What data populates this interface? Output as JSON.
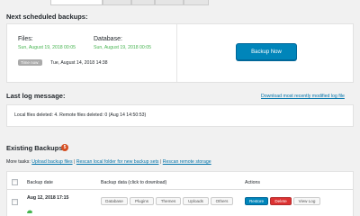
{
  "next_scheduled": {
    "heading": "Next scheduled backups:",
    "files_label": "Files:",
    "files_time": "Sun, August 19, 2018 00:05",
    "database_label": "Database:",
    "database_time": "Sun, August 19, 2018 00:05",
    "time_now_label": "Time now:",
    "time_now_value": "Tue, August 14, 2018 14:38",
    "backup_now_label": "Backup Now"
  },
  "log": {
    "heading": "Last log message:",
    "download_link": "Download most recently modified log file",
    "message": "Local files deleted: 4. Remote files deleted: 0 (Aug 14 14:50:53)"
  },
  "existing": {
    "heading": "Existing Backups",
    "count": "5",
    "more_tasks_label": "More tasks:",
    "tasks": [
      "Upload backup files",
      "Rescan local folder for new backup sets",
      "Rescan remote storage"
    ],
    "columns": [
      "Backup date",
      "Backup data (click to download)",
      "Actions"
    ],
    "rows": [
      {
        "date": "Aug 12, 2018 17:15",
        "data_buttons": [
          "Database",
          "Plugins",
          "Themes",
          "Uploads",
          "Others"
        ],
        "actions": [
          "Restore",
          "Delete",
          "View Log"
        ]
      }
    ]
  },
  "colors": {
    "primary": "#0085ba",
    "restore": "#0085ba",
    "delete": "#dc3232",
    "green": "#46b450",
    "badge": "#d54e21",
    "link": "#0073aa"
  }
}
